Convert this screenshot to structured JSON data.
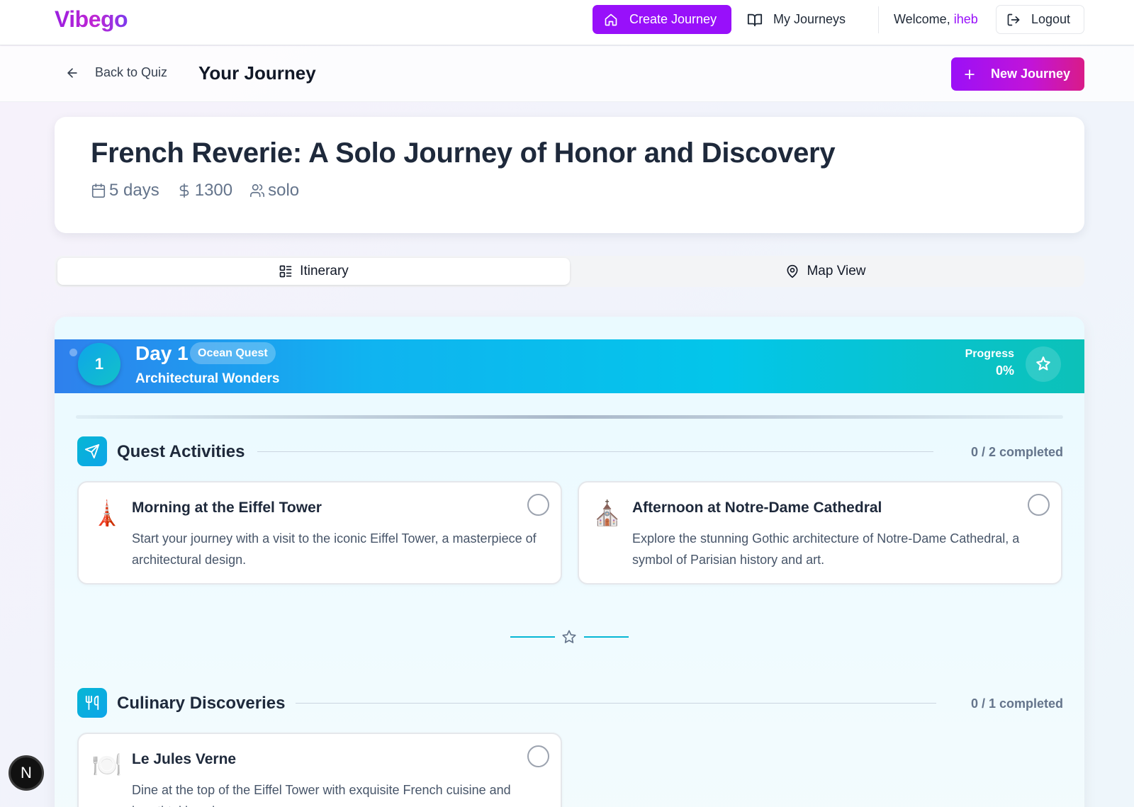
{
  "nav": {
    "logo": "Vibego",
    "create_label": "Create Journey",
    "my_journeys_label": "My Journeys",
    "welcome_prefix": "Welcome,",
    "username": "iheb",
    "logout_label": "Logout"
  },
  "subbar": {
    "back_label": "Back to Quiz",
    "title": "Your Journey",
    "new_journey_label": "New Journey"
  },
  "journey": {
    "title": "French Reverie: A Solo Journey of Honor and Discovery",
    "duration": "5 days",
    "budget": "1300",
    "group": "solo"
  },
  "tabs": {
    "itinerary": "Itinerary",
    "map": "Map View",
    "active": "itinerary"
  },
  "day": {
    "number": "1",
    "label": "Day 1",
    "badge": "Ocean Quest",
    "theme": "Architectural Wonders",
    "progress_label": "Progress",
    "progress_value": "0%",
    "progress_fraction": 0
  },
  "sections": [
    {
      "title": "Quest Activities",
      "count": "0 / 2 completed",
      "icon": "send-icon",
      "items": [
        {
          "emoji": "🗼",
          "title": "Morning at the Eiffel Tower",
          "description": "Start your journey with a visit to the iconic Eiffel Tower, a masterpiece of architectural design."
        },
        {
          "emoji": "⛪",
          "title": "Afternoon at Notre-Dame Cathedral",
          "description": "Explore the stunning Gothic architecture of Notre-Dame Cathedral, a symbol of Parisian history and art."
        }
      ]
    },
    {
      "title": "Culinary Discoveries",
      "count": "0 / 1 completed",
      "icon": "utensils-icon",
      "items": [
        {
          "emoji": "🍽️",
          "title": "Le Jules Verne",
          "description": "Dine at the top of the Eiffel Tower with exquisite French cuisine and breathtaking views."
        }
      ]
    }
  ],
  "dev_badge": "N",
  "colors": {
    "brand": "#9810fa",
    "banner_start": "#2f80ed",
    "banner_end": "#0cc1b8",
    "accent": "#06b6d4"
  }
}
